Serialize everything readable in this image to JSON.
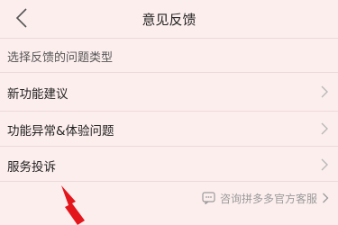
{
  "header": {
    "title": "意见反馈",
    "back_icon": "chevron-left-icon"
  },
  "section": {
    "label": "选择反馈的问题类型"
  },
  "options": [
    {
      "label": "新功能建议"
    },
    {
      "label": "功能异常&体验问题"
    },
    {
      "label": "服务投诉"
    }
  ],
  "footer": {
    "label": "咨询拼多多官方客服",
    "icon": "chat-icon"
  },
  "colors": {
    "background": "#fdeeee",
    "divider": "#ecd9d9",
    "annotation_arrow": "#e3161c"
  }
}
